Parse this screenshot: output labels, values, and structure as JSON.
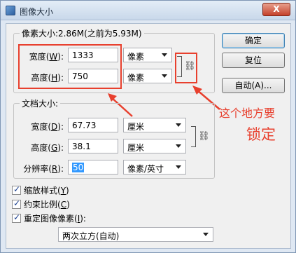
{
  "window": {
    "title": "图像大小",
    "close_glyph": "X"
  },
  "pixel_dims": {
    "group_label": "像素大小:2.86M(之前为5.93M)",
    "width": {
      "label": "宽度(",
      "key": "W",
      "suffix": "):",
      "value": "1333",
      "unit": "像素"
    },
    "height": {
      "label": "高度(",
      "key": "H",
      "suffix": "):",
      "value": "750",
      "unit": "像素"
    }
  },
  "doc_size": {
    "group_label": "文档大小:",
    "width": {
      "label": "宽度(",
      "key": "D",
      "suffix": "):",
      "value": "67.73",
      "unit": "厘米"
    },
    "height": {
      "label": "高度(",
      "key": "G",
      "suffix": "):",
      "value": "38.1",
      "unit": "厘米"
    },
    "resolution": {
      "label": "分辨率(",
      "key": "R",
      "suffix": "):",
      "value": "50",
      "unit": "像素/英寸"
    }
  },
  "buttons": {
    "ok": "确定",
    "reset": "复位",
    "auto": "自动(A)..."
  },
  "options": {
    "scale_styles": {
      "label": "缩放样式(",
      "key": "Y",
      "suffix": ")",
      "checked": true
    },
    "constrain": {
      "label": "约束比例(",
      "key": "C",
      "suffix": ")",
      "checked": true
    },
    "resample": {
      "label": "重定图像像素(",
      "key": "I",
      "suffix": "):",
      "checked": true
    },
    "resample_method": "两次立方(自动)"
  },
  "annotation": {
    "line1": "这个地方要",
    "line2": "锁定",
    "color": "#e8402e"
  },
  "icons": {
    "link": "chain-link-icon"
  }
}
